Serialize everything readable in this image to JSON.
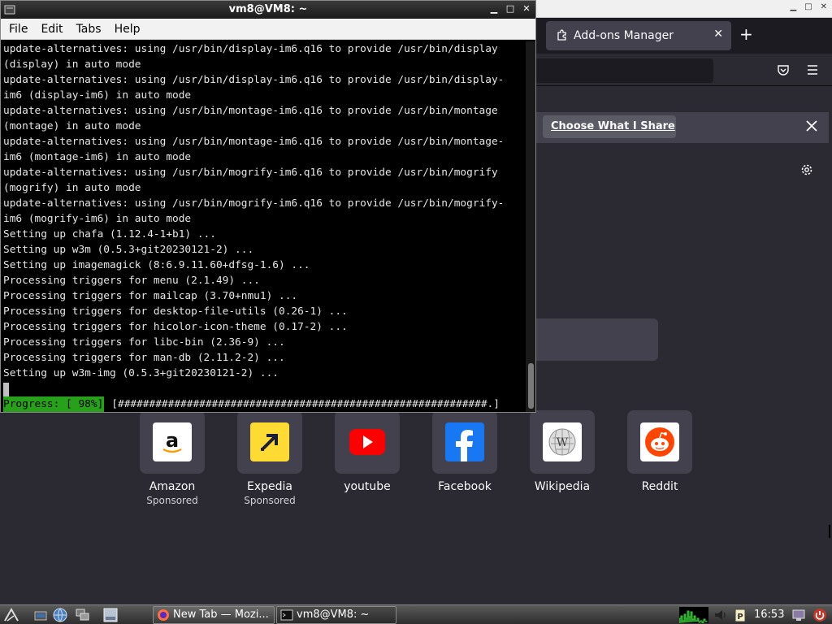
{
  "firefox": {
    "tab_title": "Add-ons Manager",
    "share_button": "Choose What I Share",
    "top_sites": [
      {
        "label": "Amazon",
        "sponsor": "Sponsored",
        "icon": "amazon-icon"
      },
      {
        "label": "Expedia",
        "sponsor": "Sponsored",
        "icon": "expedia-icon"
      },
      {
        "label": "youtube",
        "sponsor": "",
        "icon": "youtube-icon"
      },
      {
        "label": "Facebook",
        "sponsor": "",
        "icon": "facebook-icon"
      },
      {
        "label": "Wikipedia",
        "sponsor": "",
        "icon": "wikipedia-icon"
      },
      {
        "label": "Reddit",
        "sponsor": "",
        "icon": "reddit-icon"
      }
    ]
  },
  "terminal": {
    "title": "vm8@VM8: ~",
    "menu": [
      "File",
      "Edit",
      "Tabs",
      "Help"
    ],
    "lines": [
      "update-alternatives: using /usr/bin/display-im6.q16 to provide /usr/bin/display",
      "(display) in auto mode",
      "update-alternatives: using /usr/bin/display-im6.q16 to provide /usr/bin/display-",
      "im6 (display-im6) in auto mode",
      "update-alternatives: using /usr/bin/montage-im6.q16 to provide /usr/bin/montage",
      "(montage) in auto mode",
      "update-alternatives: using /usr/bin/montage-im6.q16 to provide /usr/bin/montage-",
      "im6 (montage-im6) in auto mode",
      "update-alternatives: using /usr/bin/mogrify-im6.q16 to provide /usr/bin/mogrify",
      "(mogrify) in auto mode",
      "update-alternatives: using /usr/bin/mogrify-im6.q16 to provide /usr/bin/mogrify-",
      "im6 (mogrify-im6) in auto mode",
      "Setting up chafa (1.12.4-1+b1) ...",
      "Setting up w3m (0.5.3+git20230121-2) ...",
      "Setting up imagemagick (8:6.9.11.60+dfsg-1.6) ...",
      "Processing triggers for menu (2.1.49) ...",
      "Processing triggers for mailcap (3.70+nmu1) ...",
      "Processing triggers for desktop-file-utils (0.26-1) ...",
      "Processing triggers for hicolor-icon-theme (0.17-2) ...",
      "Processing triggers for libc-bin (2.36-9) ...",
      "Processing triggers for man-db (2.11.2-2) ...",
      "Setting up w3m-img (0.5.3+git20230121-2) ..."
    ],
    "progress_label": "Progress: [ 98%]",
    "progress_bar": "[###########################################################.]",
    "progress_percent": 98
  },
  "taskbar": {
    "tasks": [
      "New Tab — Mozi...",
      "vm8@VM8: ~"
    ],
    "clock": "16:53"
  },
  "colors": {
    "terminal_bg": "#000000",
    "progress_green": "#28a11a",
    "firefox_bg": "#2b2a33"
  }
}
